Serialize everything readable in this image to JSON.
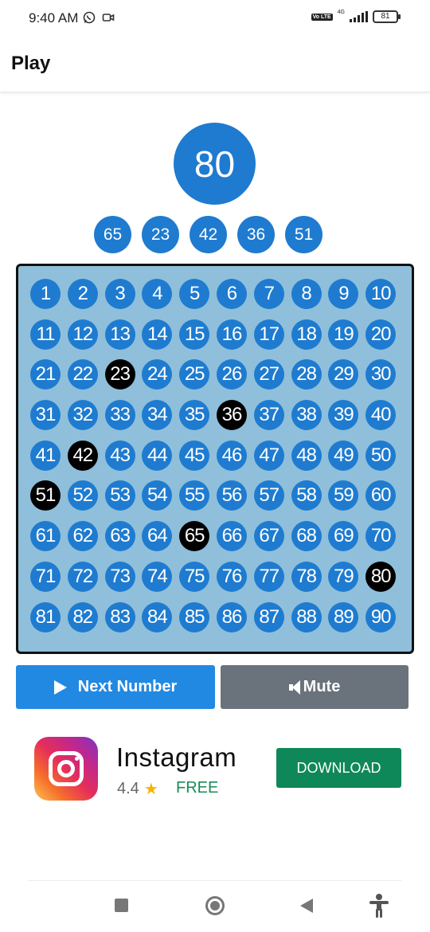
{
  "status_bar": {
    "time": "9:40 AM",
    "volte": "Vo LTE",
    "network": "4G",
    "battery": "81"
  },
  "app_bar": {
    "title": "Play"
  },
  "current_number": "80",
  "recent_numbers": [
    "65",
    "23",
    "42",
    "36",
    "51"
  ],
  "board": {
    "numbers": [
      "1",
      "2",
      "3",
      "4",
      "5",
      "6",
      "7",
      "8",
      "9",
      "10",
      "11",
      "12",
      "13",
      "14",
      "15",
      "16",
      "17",
      "18",
      "19",
      "20",
      "21",
      "22",
      "23",
      "24",
      "25",
      "26",
      "27",
      "28",
      "29",
      "30",
      "31",
      "32",
      "33",
      "34",
      "35",
      "36",
      "37",
      "38",
      "39",
      "40",
      "41",
      "42",
      "43",
      "44",
      "45",
      "46",
      "47",
      "48",
      "49",
      "50",
      "51",
      "52",
      "53",
      "54",
      "55",
      "56",
      "57",
      "58",
      "59",
      "60",
      "61",
      "62",
      "63",
      "64",
      "65",
      "66",
      "67",
      "68",
      "69",
      "70",
      "71",
      "72",
      "73",
      "74",
      "75",
      "76",
      "77",
      "78",
      "79",
      "80",
      "81",
      "82",
      "83",
      "84",
      "85",
      "86",
      "87",
      "88",
      "89",
      "90"
    ],
    "called": [
      "23",
      "36",
      "42",
      "51",
      "65",
      "80"
    ]
  },
  "controls": {
    "next_label": "Next Number",
    "mute_label": "Mute"
  },
  "ad": {
    "app_name": "Instagram",
    "rating": "4.4",
    "price": "FREE",
    "cta": "DOWNLOAD"
  },
  "colors": {
    "ball": "#1e7bd0",
    "called_ball": "#000000",
    "board_bg": "#8fbfda",
    "next_button": "#2289e3",
    "mute_button": "#6a737c",
    "download_button": "#0f8859"
  },
  "icons": {
    "status_left": [
      "whatsapp-icon",
      "video-camera-icon"
    ],
    "next": "play-icon",
    "mute": "speaker-icon",
    "rating": "star-icon",
    "nav": [
      "recents-square-icon",
      "home-circle-icon",
      "back-triangle-icon",
      "accessibility-icon"
    ]
  }
}
